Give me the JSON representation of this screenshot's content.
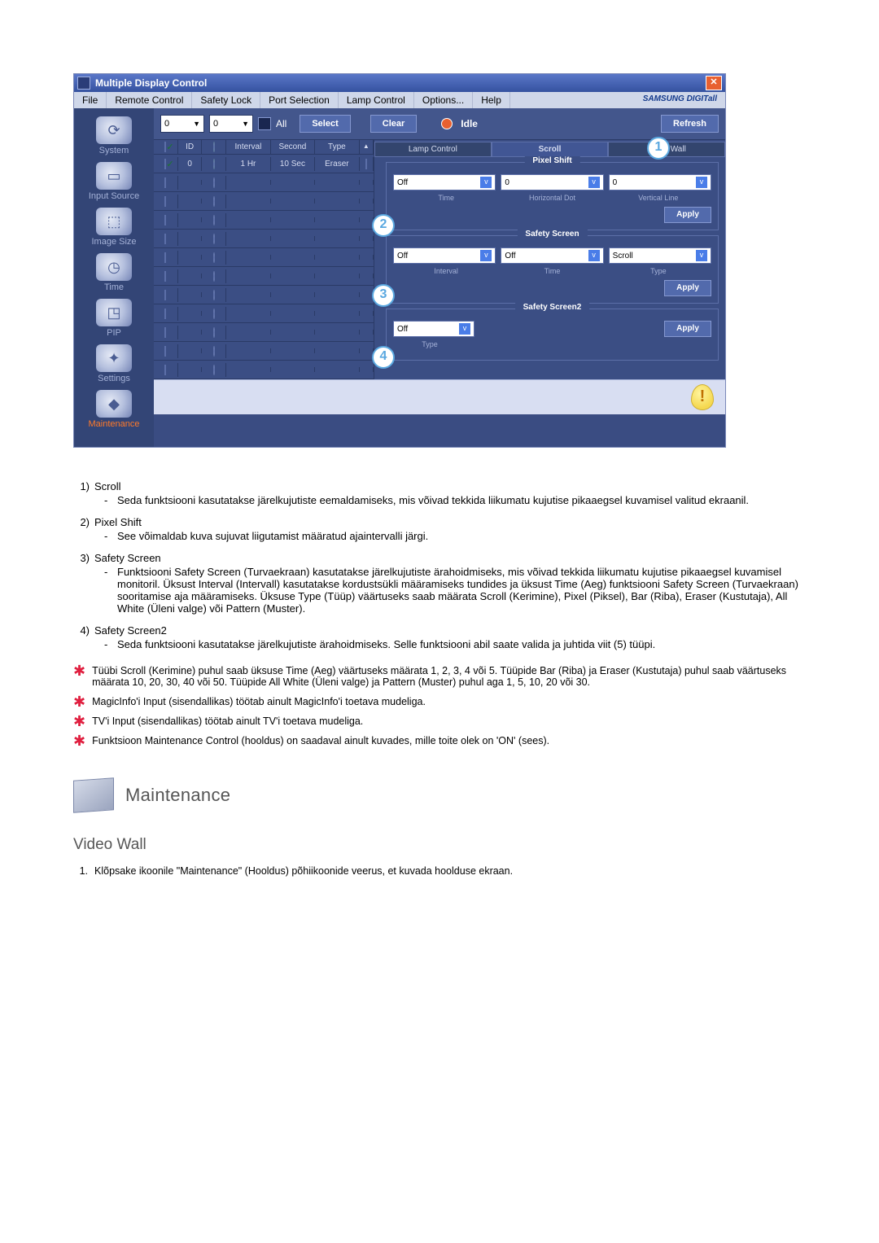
{
  "window": {
    "title": "Multiple Display Control"
  },
  "menubar": {
    "items": [
      "File",
      "Remote Control",
      "Safety Lock",
      "Port Selection",
      "Lamp Control",
      "Options...",
      "Help"
    ],
    "brand": "SAMSUNG DIGITall"
  },
  "sidebar": {
    "items": [
      {
        "label": "System",
        "glyph": "⟳"
      },
      {
        "label": "Input Source",
        "glyph": "▭"
      },
      {
        "label": "Image Size",
        "glyph": "⬚"
      },
      {
        "label": "Time",
        "glyph": "◷"
      },
      {
        "label": "PIP",
        "glyph": "◳"
      },
      {
        "label": "Settings",
        "glyph": "✦"
      },
      {
        "label": "Maintenance",
        "glyph": "◆"
      }
    ],
    "active_index": 6
  },
  "topbar": {
    "combo1": "0",
    "combo2": "0",
    "all_label": "All",
    "select_btn": "Select",
    "clear_btn": "Clear",
    "idle_label": "Idle",
    "refresh_btn": "Refresh"
  },
  "table": {
    "headers": {
      "id": "ID",
      "interval": "Interval",
      "second": "Second",
      "type": "Type"
    },
    "rows": [
      {
        "checked": true,
        "id": "0",
        "on": true,
        "interval": "1 Hr",
        "second": "10 Sec",
        "type": "Eraser"
      },
      {
        "checked": false,
        "id": "",
        "on": false,
        "interval": "",
        "second": "",
        "type": ""
      },
      {
        "checked": false,
        "id": "",
        "on": false,
        "interval": "",
        "second": "",
        "type": ""
      },
      {
        "checked": false,
        "id": "",
        "on": false,
        "interval": "",
        "second": "",
        "type": ""
      },
      {
        "checked": false,
        "id": "",
        "on": false,
        "interval": "",
        "second": "",
        "type": ""
      },
      {
        "checked": false,
        "id": "",
        "on": false,
        "interval": "",
        "second": "",
        "type": ""
      },
      {
        "checked": false,
        "id": "",
        "on": false,
        "interval": "",
        "second": "",
        "type": ""
      },
      {
        "checked": false,
        "id": "",
        "on": false,
        "interval": "",
        "second": "",
        "type": ""
      },
      {
        "checked": false,
        "id": "",
        "on": false,
        "interval": "",
        "second": "",
        "type": ""
      },
      {
        "checked": false,
        "id": "",
        "on": false,
        "interval": "",
        "second": "",
        "type": ""
      },
      {
        "checked": false,
        "id": "",
        "on": false,
        "interval": "",
        "second": "",
        "type": ""
      },
      {
        "checked": false,
        "id": "",
        "on": false,
        "interval": "",
        "second": "",
        "type": ""
      }
    ]
  },
  "right_tabs": {
    "items": [
      "Lamp Control",
      "Scroll",
      "Video Wall"
    ],
    "active_index": 1
  },
  "pixel_shift": {
    "title": "Pixel Shift",
    "time_val": "Off",
    "hdot_val": "0",
    "vline_val": "0",
    "labels": {
      "time": "Time",
      "hdot": "Horizontal Dot",
      "vline": "Vertical Line"
    },
    "apply": "Apply"
  },
  "safety_screen": {
    "title": "Safety Screen",
    "interval_val": "Off",
    "time_val": "Off",
    "type_val": "Scroll",
    "labels": {
      "interval": "Interval",
      "time": "Time",
      "type": "Type"
    },
    "apply": "Apply"
  },
  "safety_screen2": {
    "title": "Safety Screen2",
    "type_val": "Off",
    "labels": {
      "type": "Type"
    },
    "apply": "Apply"
  },
  "callouts": {
    "c1": "1",
    "c2": "2",
    "c3": "3",
    "c4": "4"
  },
  "descriptions": [
    {
      "num": "1)",
      "title": "Scroll",
      "body": "Seda funktsiooni kasutatakse järelkujutiste eemaldamiseks, mis võivad tekkida liikumatu kujutise pikaaegsel kuvamisel valitud ekraanil."
    },
    {
      "num": "2)",
      "title": "Pixel Shift",
      "body": "See võimaldab kuva sujuvat liigutamist määratud ajaintervalli järgi."
    },
    {
      "num": "3)",
      "title": "Safety Screen",
      "body": "Funktsiooni Safety Screen (Turvaekraan) kasutatakse järelkujutiste ärahoidmiseks, mis võivad tekkida liikumatu kujutise pikaaegsel kuvamisel monitoril.  Üksust Interval (Intervall) kasutatakse kordustsükli määramiseks tundides ja üksust Time (Aeg) funktsiooni Safety Screen (Turvaekraan) sooritamise aja määramiseks. Üksuse Type (Tüüp) väärtuseks saab määrata Scroll (Kerimine), Pixel (Piksel), Bar (Riba), Eraser (Kustutaja), All White (Üleni valge) või Pattern (Muster)."
    },
    {
      "num": "4)",
      "title": "Safety Screen2",
      "body": "Seda funktsiooni kasutatakse järelkujutiste ärahoidmiseks. Selle funktsiooni abil saate valida ja juhtida viit (5) tüüpi."
    }
  ],
  "stars": [
    "Tüübi Scroll (Kerimine) puhul saab üksuse Time (Aeg) väärtuseks määrata 1, 2, 3, 4 või 5. Tüüpide Bar (Riba) ja Eraser (Kustutaja) puhul saab väärtuseks määrata 10, 20, 30, 40 või 50. Tüüpide All White (Üleni valge) ja Pattern (Muster) puhul aga 1, 5, 10, 20 või 30.",
    "MagicInfo'i Input (sisendallikas) töötab ainult MagicInfo'i toetava mudeliga.",
    "TV'i Input (sisendallikas) töötab ainult TV'i toetava mudeliga.",
    "Funktsioon Maintenance Control (hooldus) on saadaval ainult kuvades, mille toite olek on 'ON' (sees)."
  ],
  "section": {
    "title": "Maintenance",
    "sub": "Video Wall",
    "para_num": "1.",
    "para": "Klõpsake ikoonile \"Maintenance\" (Hooldus) põhiikoonide veerus, et kuvada hoolduse ekraan."
  }
}
